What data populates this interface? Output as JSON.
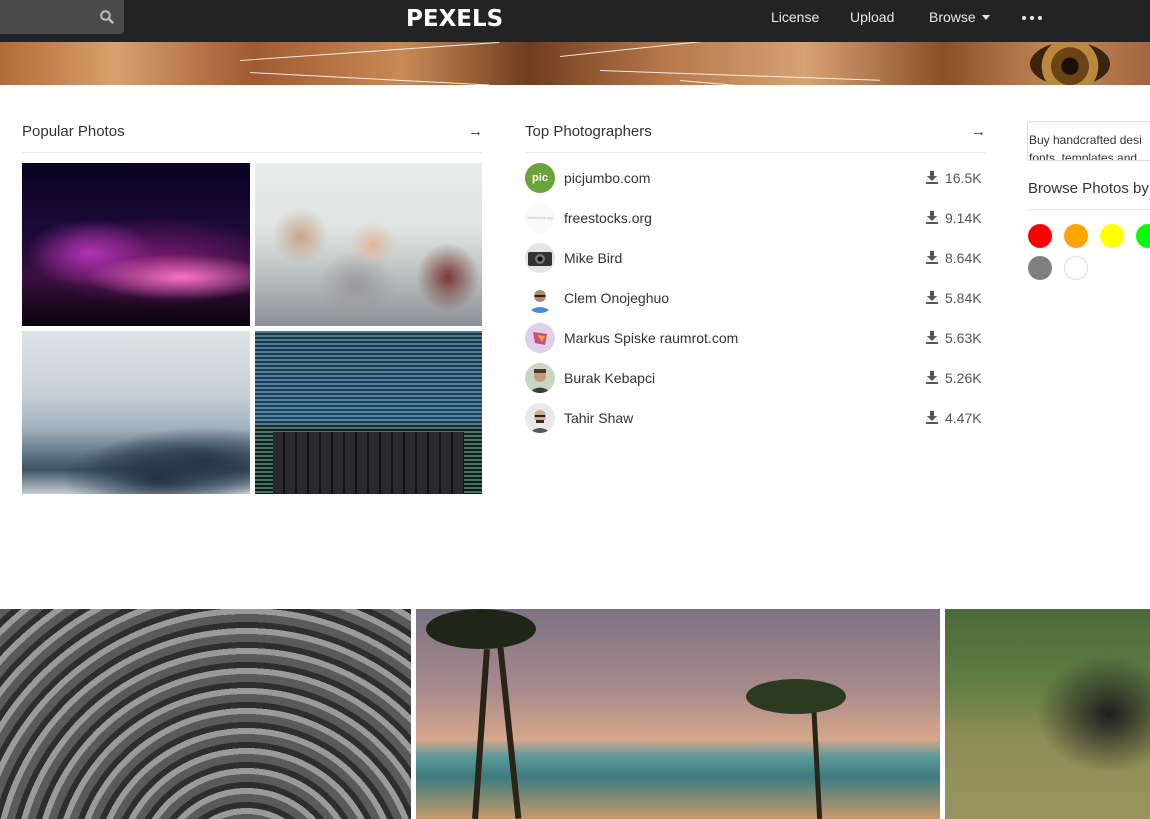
{
  "header": {
    "search_placeholder": "",
    "logo": "PEXELS",
    "nav": {
      "license": "License",
      "upload": "Upload",
      "browse": "Browse"
    }
  },
  "popular": {
    "title": "Popular Photos",
    "arrow": "→"
  },
  "photographers": {
    "title": "Top Photographers",
    "arrow": "→",
    "items": [
      {
        "name": "picjumbo.com",
        "downloads": "16.5K",
        "avatar_text": "pic"
      },
      {
        "name": "freestocks.org",
        "downloads": "9.14K",
        "avatar_text": "freestocks.org"
      },
      {
        "name": "Mike Bird",
        "downloads": "8.64K"
      },
      {
        "name": "Clem Onojeghuo",
        "downloads": "5.84K"
      },
      {
        "name": "Markus Spiske raumrot.com",
        "downloads": "5.63K"
      },
      {
        "name": "Burak Kebapci",
        "downloads": "5.26K"
      },
      {
        "name": "Tahir Shaw",
        "downloads": "4.47K"
      }
    ]
  },
  "sidebar": {
    "ad_line1": "Buy handcrafted desi",
    "ad_line2": "fonts, templates and",
    "browse_title": "Browse Photos by",
    "colors": [
      "#ff0000",
      "#ffa500",
      "#ffff00",
      "#00ff00",
      "#808080",
      "#ffffff"
    ]
  }
}
